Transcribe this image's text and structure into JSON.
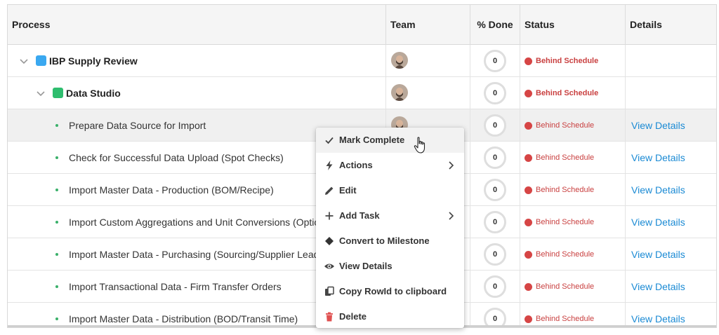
{
  "columns": {
    "process": "Process",
    "team": "Team",
    "done": "% Done",
    "status": "Status",
    "details": "Details"
  },
  "rows": [
    {
      "name": "IBP Supply Review",
      "level": 0,
      "percent": "0",
      "status": "Behind Schedule",
      "details": "",
      "swatch": "#3aa8f0"
    },
    {
      "name": "Data Studio",
      "level": 1,
      "percent": "0",
      "status": "Behind Schedule",
      "details": "",
      "swatch": "#2ebd6e"
    },
    {
      "name": "Prepare Data Source for Import",
      "level": 2,
      "percent": "0",
      "status": "Behind Schedule",
      "details": "View Details"
    },
    {
      "name": "Check for Successful Data Upload (Spot Checks)",
      "level": 2,
      "percent": "0",
      "status": "Behind Schedule",
      "details": "View Details"
    },
    {
      "name": "Import Master Data - Production (BOM/Recipe)",
      "level": 2,
      "percent": "0",
      "status": "Behind Schedule",
      "details": "View Details"
    },
    {
      "name": "Import Custom Aggregations and Unit Conversions (Optio",
      "level": 2,
      "percent": "0",
      "status": "Behind Schedule",
      "details": "View Details"
    },
    {
      "name": "Import Master Data - Purchasing (Sourcing/Supplier Lead",
      "level": 2,
      "percent": "0",
      "status": "Behind Schedule",
      "details": "View Details"
    },
    {
      "name": "Import Transactional Data - Firm Transfer Orders",
      "level": 2,
      "percent": "0",
      "status": "Behind Schedule",
      "details": "View Details"
    },
    {
      "name": "Import Master Data - Distribution (BOD/Transit Time)",
      "level": 2,
      "percent": "0",
      "status": "Behind Schedule",
      "details": "View Details"
    }
  ],
  "context_menu": {
    "mark_complete": "Mark Complete",
    "actions": "Actions",
    "edit": "Edit",
    "add_task": "Add Task",
    "convert_milestone": "Convert to Milestone",
    "view_details": "View Details",
    "copy_rowid": "Copy RowId to clipboard",
    "delete": "Delete"
  },
  "colors": {
    "status_behind": "#d64545",
    "link": "#1a8ad4",
    "delete_icon": "#e05050"
  }
}
